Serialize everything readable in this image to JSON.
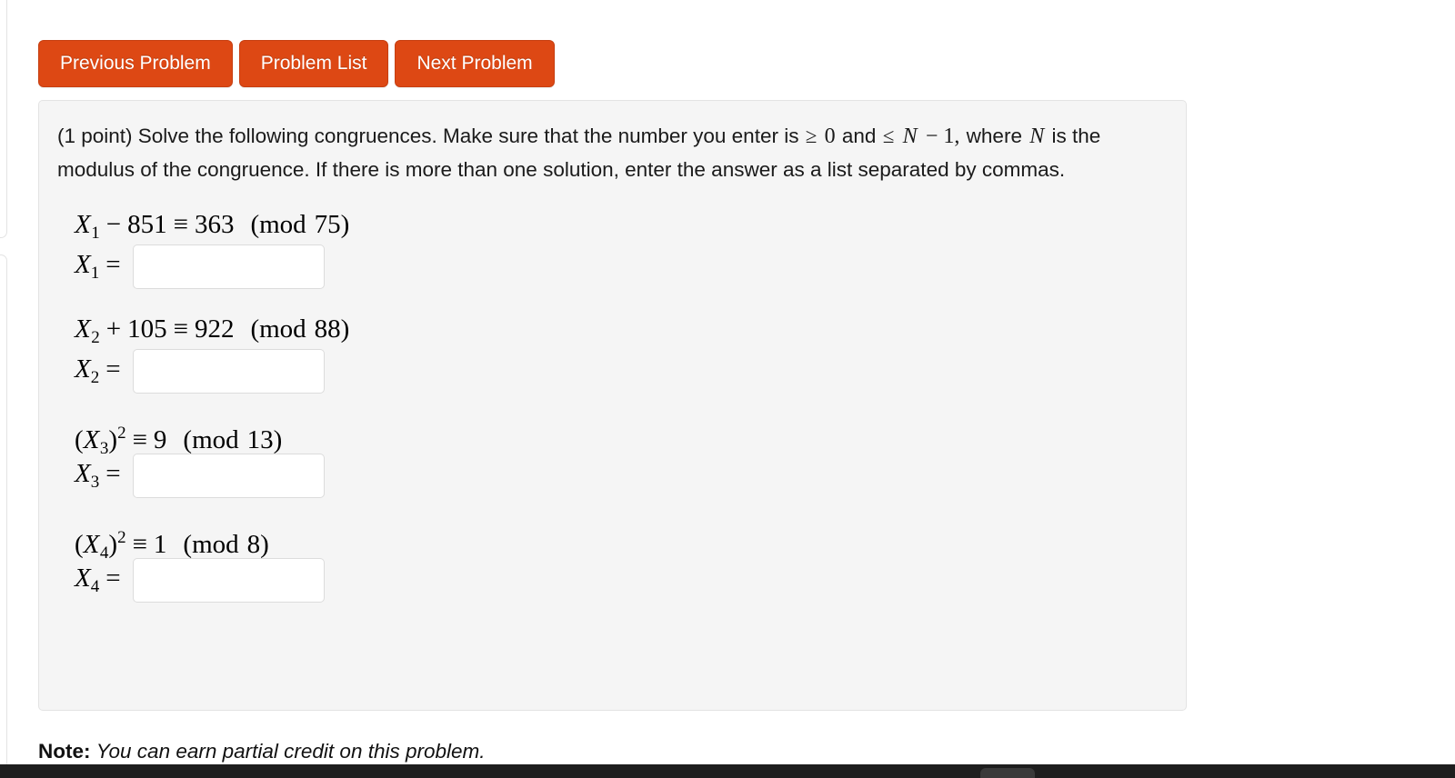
{
  "window": {
    "background_color": "#ffffff",
    "taskbar_color": "#1e1e1e"
  },
  "toolbar": {
    "accent_color": "#dd4814",
    "buttons": [
      {
        "label": "Previous Problem",
        "name": "previous-problem-button"
      },
      {
        "label": "Problem List",
        "name": "problem-list-button"
      },
      {
        "label": "Next Problem",
        "name": "next-problem-button"
      }
    ]
  },
  "problem": {
    "panel_background": "#f5f5f5",
    "points": "(1 point)",
    "statement": {
      "part1": "(1 point) Solve the following congruences. Make sure that the number you enter is",
      "rel_ge": "≥",
      "zero": "0",
      "and": "and",
      "rel_le": "≤",
      "modulus_symbol": "N",
      "minus_one": "− 1,",
      "part2": "where",
      "modulus_symbol2": "N",
      "part3": "is the modulus of the congruence. If there is more than one solution, enter the answer as a list",
      "part4": "separated by commas."
    },
    "congruences": [
      {
        "id": "x1",
        "variable": "X",
        "subscript": "1",
        "exponent": "",
        "operator": "−",
        "operand": "851",
        "relation": "≡",
        "right_side": "363",
        "mod_word": "(mod",
        "modulus": "75)",
        "answer_label_var": "X",
        "answer_label_sub": "1",
        "answer_label_eq": "=",
        "answer_value": "",
        "answer_placeholder": ""
      },
      {
        "id": "x2",
        "variable": "X",
        "subscript": "2",
        "exponent": "",
        "operator": "+",
        "operand": "105",
        "relation": "≡",
        "right_side": "922",
        "mod_word": "(mod",
        "modulus": "88)",
        "answer_label_var": "X",
        "answer_label_sub": "2",
        "answer_label_eq": "=",
        "answer_value": "",
        "answer_placeholder": ""
      },
      {
        "id": "x3",
        "variable": "X",
        "subscript": "3",
        "exponent": "2",
        "operator": "",
        "operand": "",
        "relation": "≡",
        "right_side": "9",
        "mod_word": "(mod",
        "modulus": "13)",
        "answer_label_var": "X",
        "answer_label_sub": "3",
        "answer_label_eq": "=",
        "answer_value": "",
        "answer_placeholder": ""
      },
      {
        "id": "x4",
        "variable": "X",
        "subscript": "4",
        "exponent": "2",
        "operator": "",
        "operand": "",
        "relation": "≡",
        "right_side": "1",
        "mod_word": "(mod",
        "modulus": "8)",
        "answer_label_var": "X",
        "answer_label_sub": "4",
        "answer_label_eq": "=",
        "answer_value": "",
        "answer_placeholder": ""
      }
    ]
  },
  "note": {
    "prefix": "Note:",
    "text": "You can earn partial credit on this problem."
  }
}
